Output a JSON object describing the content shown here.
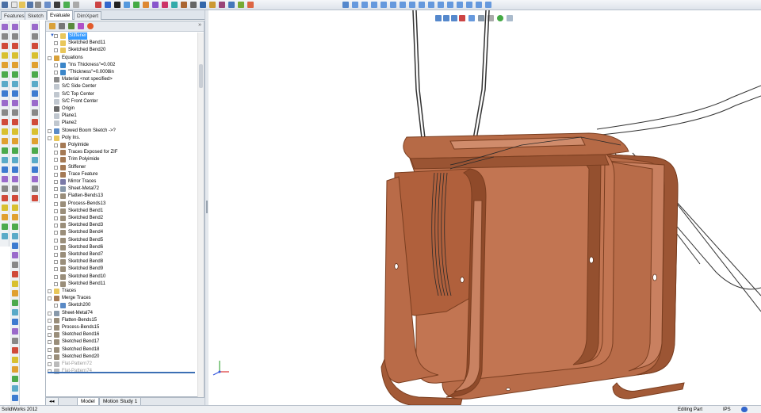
{
  "cm_tabs": {
    "features": "Features",
    "sketch": "Sketch",
    "evaluate": "Evaluate",
    "dimxpert": "DimXpert"
  },
  "tree": [
    {
      "label": "Stiffener",
      "indent": 1,
      "icon": "folder",
      "selected": true
    },
    {
      "label": "Sketched Bend11",
      "indent": 1,
      "icon": "folder"
    },
    {
      "label": "Sketched Bend20",
      "indent": 1,
      "icon": "folder"
    },
    {
      "label": "Equations",
      "indent": 0,
      "icon": "equation"
    },
    {
      "label": "\"Ins Thickness\"=0.002",
      "indent": 1,
      "icon": "equation-item"
    },
    {
      "label": "\"Thickness\"=0.0008in",
      "indent": 1,
      "icon": "equation-item"
    },
    {
      "label": "Material <not specified>",
      "indent": 0,
      "icon": "material"
    },
    {
      "label": "S/C Side Center",
      "indent": 0,
      "icon": "plane"
    },
    {
      "label": "S/C Top Center",
      "indent": 0,
      "icon": "plane"
    },
    {
      "label": "S/C Front Center",
      "indent": 0,
      "icon": "plane"
    },
    {
      "label": "Origin",
      "indent": 0,
      "icon": "origin"
    },
    {
      "label": "Plane1",
      "indent": 0,
      "icon": "plane"
    },
    {
      "label": "Plane2",
      "indent": 0,
      "icon": "plane"
    },
    {
      "label": "Stowed Boom Sketch ->?",
      "indent": 0,
      "icon": "sketch"
    },
    {
      "label": "Poly Ins.",
      "indent": 0,
      "icon": "folder"
    },
    {
      "label": "Polyimide",
      "indent": 1,
      "icon": "feature"
    },
    {
      "label": "Traces Exposed for ZIF",
      "indent": 1,
      "icon": "feature"
    },
    {
      "label": "Trim Polyimide",
      "indent": 1,
      "icon": "feature"
    },
    {
      "label": "Stiffener",
      "indent": 1,
      "icon": "feature"
    },
    {
      "label": "Trace Feature",
      "indent": 1,
      "icon": "feature"
    },
    {
      "label": "Mirror Traces",
      "indent": 1,
      "icon": "mirror"
    },
    {
      "label": "Sheet-Metal72",
      "indent": 1,
      "icon": "sheetmetal"
    },
    {
      "label": "Flatten-Bends13",
      "indent": 1,
      "icon": "bend"
    },
    {
      "label": "Process-Bends13",
      "indent": 1,
      "icon": "bend"
    },
    {
      "label": "Sketched Bend1",
      "indent": 1,
      "icon": "bend"
    },
    {
      "label": "Sketched Bend2",
      "indent": 1,
      "icon": "bend"
    },
    {
      "label": "Sketched Bend3",
      "indent": 1,
      "icon": "bend"
    },
    {
      "label": "Sketched Bend4",
      "indent": 1,
      "icon": "bend"
    },
    {
      "label": "Sketched Bend5",
      "indent": 1,
      "icon": "bend"
    },
    {
      "label": "Sketched Bend6",
      "indent": 1,
      "icon": "bend"
    },
    {
      "label": "Sketched Bend7",
      "indent": 1,
      "icon": "bend"
    },
    {
      "label": "Sketched Bend8",
      "indent": 1,
      "icon": "bend"
    },
    {
      "label": "Sketched Bend9",
      "indent": 1,
      "icon": "bend"
    },
    {
      "label": "Sketched Bend10",
      "indent": 1,
      "icon": "bend"
    },
    {
      "label": "Sketched Bend11",
      "indent": 1,
      "icon": "bend"
    },
    {
      "label": "Traces",
      "indent": 0,
      "icon": "folder"
    },
    {
      "label": "Merge Traces",
      "indent": 0,
      "icon": "feature"
    },
    {
      "label": "Sketch200",
      "indent": 1,
      "icon": "sketch"
    },
    {
      "label": "Sheet-Metal74",
      "indent": 0,
      "icon": "sheetmetal"
    },
    {
      "label": "Flatten-Bends15",
      "indent": 0,
      "icon": "bend"
    },
    {
      "label": "Process-Bends15",
      "indent": 0,
      "icon": "bend"
    },
    {
      "label": "Sketched Bend16",
      "indent": 0,
      "icon": "bend"
    },
    {
      "label": "Sketched Bend17",
      "indent": 0,
      "icon": "bend"
    },
    {
      "label": "Sketched Bend18",
      "indent": 0,
      "icon": "bend"
    },
    {
      "label": "Sketched Bend20",
      "indent": 0,
      "icon": "bend"
    },
    {
      "label": "Flat-Pattern72",
      "indent": 0,
      "icon": "flat",
      "dim": true
    },
    {
      "label": "Flat-Pattern74",
      "indent": 0,
      "icon": "flat",
      "dim": true
    }
  ],
  "bottom_tabs": {
    "model": "Model",
    "motion": "Motion Study 1"
  },
  "status": {
    "app": "SolidWorks 2012",
    "mode": "Editing Part",
    "units": "IPS"
  },
  "colors": {
    "copper": "#c47a55",
    "copper_dark": "#8a4a2c",
    "selection": "#3399ff"
  }
}
